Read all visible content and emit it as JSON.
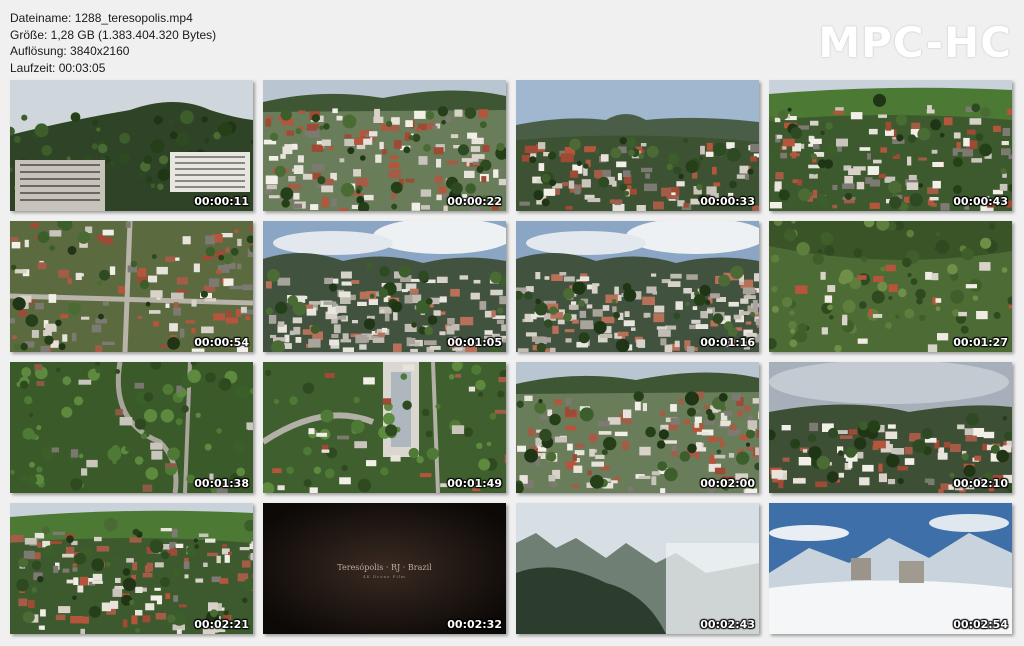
{
  "file_info": {
    "filename": "Dateiname: 1288_teresopolis.mp4",
    "size": "Größe: 1,28 GB (1.383.404.320 Bytes)",
    "resolution": "Auflösung: 3840x2160",
    "duration": "Laufzeit: 00:03:05"
  },
  "logo": "MPC-HC",
  "thumbnails": [
    {
      "time": "00:00:11",
      "scene": "city-hill"
    },
    {
      "time": "00:00:22",
      "scene": "town-dense"
    },
    {
      "time": "00:00:33",
      "scene": "valley-mountains"
    },
    {
      "time": "00:00:43",
      "scene": "town-slope"
    },
    {
      "time": "00:00:54",
      "scene": "top-down-houses"
    },
    {
      "time": "00:01:05",
      "scene": "panorama-clouds"
    },
    {
      "time": "00:01:16",
      "scene": "panorama-clouds"
    },
    {
      "time": "00:01:27",
      "scene": "green-hills-villas"
    },
    {
      "time": "00:01:38",
      "scene": "top-down-green"
    },
    {
      "time": "00:01:49",
      "scene": "top-down-roads"
    },
    {
      "time": "00:02:00",
      "scene": "town-dense"
    },
    {
      "time": "00:02:10",
      "scene": "cloudy-town"
    },
    {
      "time": "00:02:21",
      "scene": "town-slope"
    },
    {
      "time": "00:02:32",
      "scene": "title-card"
    },
    {
      "time": "00:02:43",
      "scene": "misty-peaks"
    },
    {
      "time": "00:02:54",
      "scene": "snow-mountains"
    }
  ],
  "title_card": {
    "line1": "Teresópolis · RJ · Brazil",
    "line2": "4K Drone Film"
  }
}
